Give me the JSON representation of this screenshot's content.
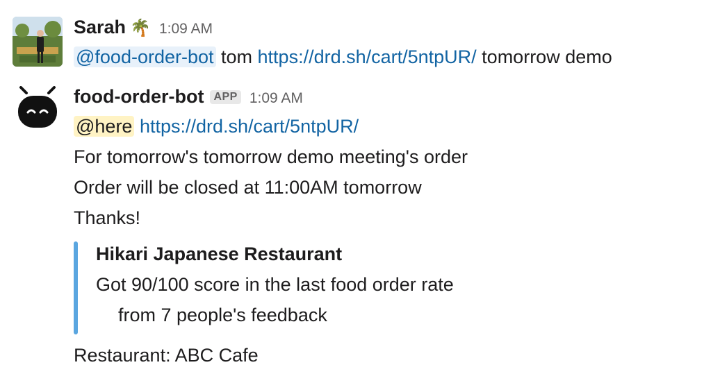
{
  "messages": [
    {
      "sender": "Sarah",
      "status_emoji": "🌴",
      "time": "1:09 AM",
      "mention": "@food-order-bot",
      "text_1": " tom ",
      "link": "https://drd.sh/cart/5ntpUR/",
      "text_2": " tomorrow demo"
    },
    {
      "sender": "food-order-bot",
      "badge": "APP",
      "time": "1:09 AM",
      "here_mention": "@here",
      "link": "https://drd.sh/cart/5ntpUR/",
      "lines": [
        "For tomorrow's tomorrow demo meeting's order",
        "Order will be closed at 11:00AM tomorrow",
        "Thanks!"
      ],
      "attachment": {
        "title": "Hikari Japanese Restaurant",
        "line_1": "Got 90/100 score in the last food order rate",
        "line_2": "from 7 people's feedback"
      },
      "footer": "Restaurant: ABC Cafe"
    }
  ]
}
